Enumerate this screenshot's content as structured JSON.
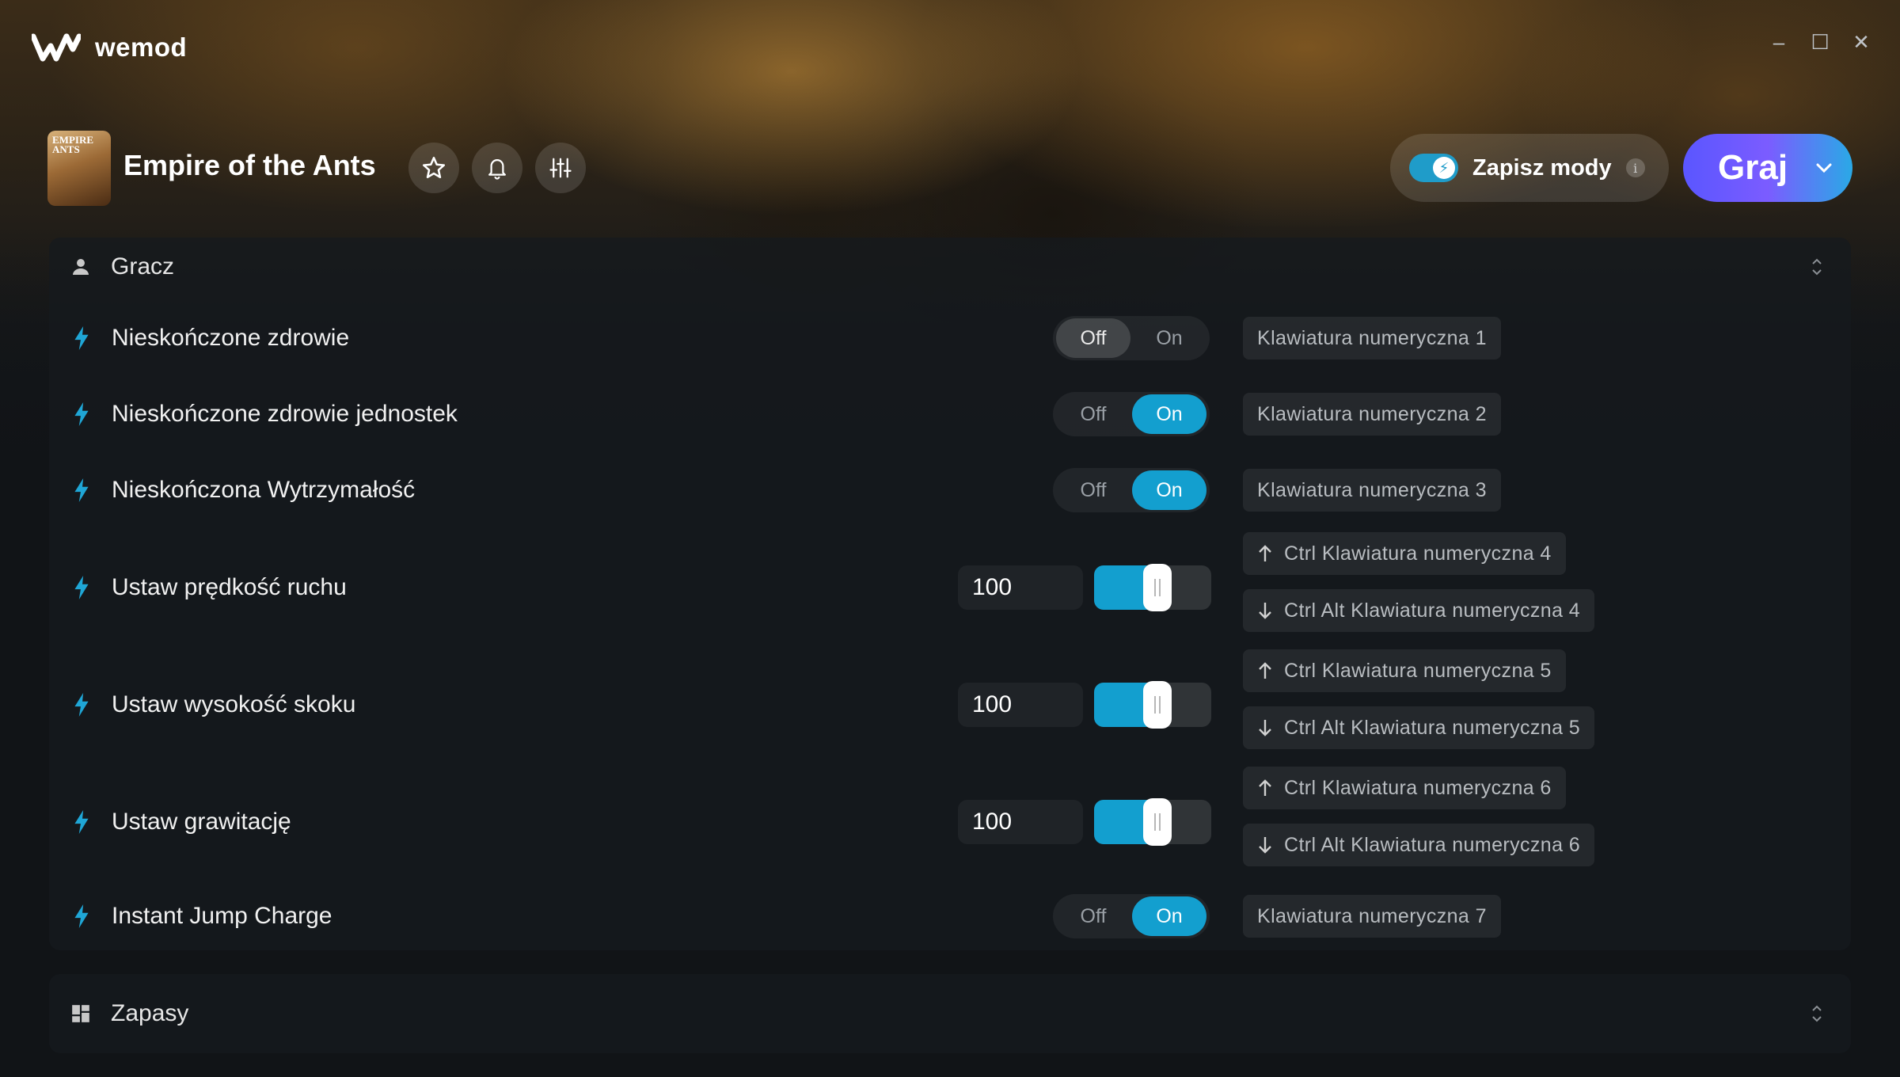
{
  "app": {
    "name": "wemod"
  },
  "window_controls": {
    "minimize": "–",
    "maximize": "☐",
    "close": "✕"
  },
  "header": {
    "game_title": "Empire of the Ants",
    "thumb_text": "EMPIRE ANTS",
    "save_mods": {
      "label": "Zapisz mody",
      "info": "i",
      "enabled": true
    },
    "play": {
      "label": "Graj"
    }
  },
  "colors": {
    "accent": "#139fcf",
    "play_start": "#5a56ff",
    "play_end": "#2aa9e6"
  },
  "categories": [
    {
      "title": "Gracz",
      "icon": "user-icon",
      "mods": [
        {
          "name": "Nieskończone zdrowie",
          "type": "toggle",
          "state": "Off",
          "off_label": "Off",
          "on_label": "On",
          "hotkeys": [
            "Klawiatura numeryczna 1"
          ]
        },
        {
          "name": "Nieskończone zdrowie jednostek",
          "type": "toggle",
          "state": "On",
          "off_label": "Off",
          "on_label": "On",
          "hotkeys": [
            "Klawiatura numeryczna 2"
          ]
        },
        {
          "name": "Nieskończona Wytrzymałość",
          "type": "toggle",
          "state": "On",
          "off_label": "Off",
          "on_label": "On",
          "hotkeys": [
            "Klawiatura numeryczna 3"
          ]
        },
        {
          "name": "Ustaw prędkość ruchu",
          "type": "slider",
          "value": "100",
          "fill": 0.42,
          "hotkeys": [
            "Ctrl Klawiatura numeryczna 4",
            "Ctrl Alt Klawiatura numeryczna 4"
          ]
        },
        {
          "name": "Ustaw wysokość skoku",
          "type": "slider",
          "value": "100",
          "fill": 0.42,
          "hotkeys": [
            "Ctrl Klawiatura numeryczna 5",
            "Ctrl Alt Klawiatura numeryczna 5"
          ]
        },
        {
          "name": "Ustaw grawitację",
          "type": "slider",
          "value": "100",
          "fill": 0.42,
          "hotkeys": [
            "Ctrl Klawiatura numeryczna 6",
            "Ctrl Alt Klawiatura numeryczna 6"
          ]
        },
        {
          "name": "Instant Jump Charge",
          "type": "toggle",
          "state": "On",
          "off_label": "Off",
          "on_label": "On",
          "hotkeys": [
            "Klawiatura numeryczna 7"
          ]
        }
      ]
    },
    {
      "title": "Zapasy",
      "icon": "grid-icon"
    }
  ]
}
